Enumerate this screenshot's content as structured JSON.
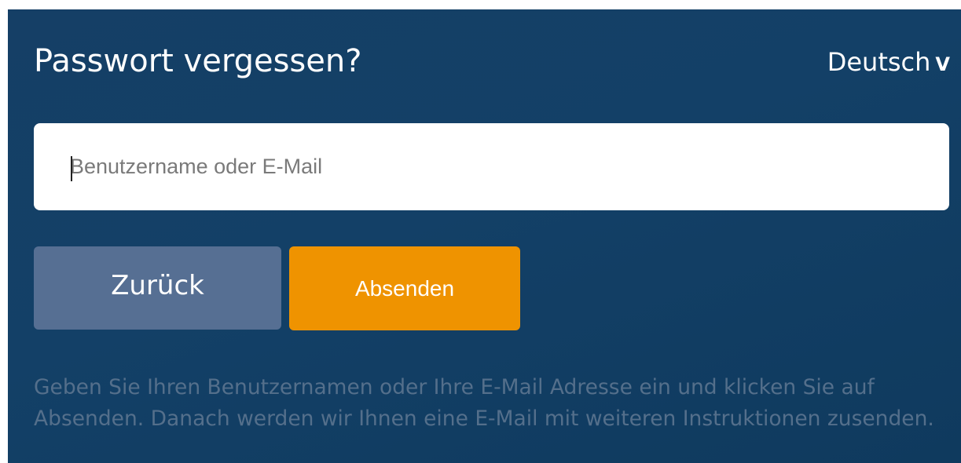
{
  "page": {
    "title": "Passwort vergessen?",
    "language": {
      "label": "Deutsch",
      "chevron": "V"
    }
  },
  "form": {
    "username_field": {
      "value": "",
      "placeholder": "Benutzername oder E-Mail"
    },
    "back_label": "Zurück",
    "submit_label": "Absenden"
  },
  "help_text": "Geben Sie Ihren Benutzernamen oder Ihre E-Mail Adresse ein und klicken Sie auf Absenden. Danach werden wir Ihnen eine E-Mail mit weiteren Instruktionen zusenden.",
  "colors": {
    "panel_background": "#134067",
    "back_button": "#566f93",
    "submit_button": "#ef9300",
    "help_text": "#546f8b"
  },
  "icons": {
    "language_dropdown": "chevron-down-icon"
  }
}
